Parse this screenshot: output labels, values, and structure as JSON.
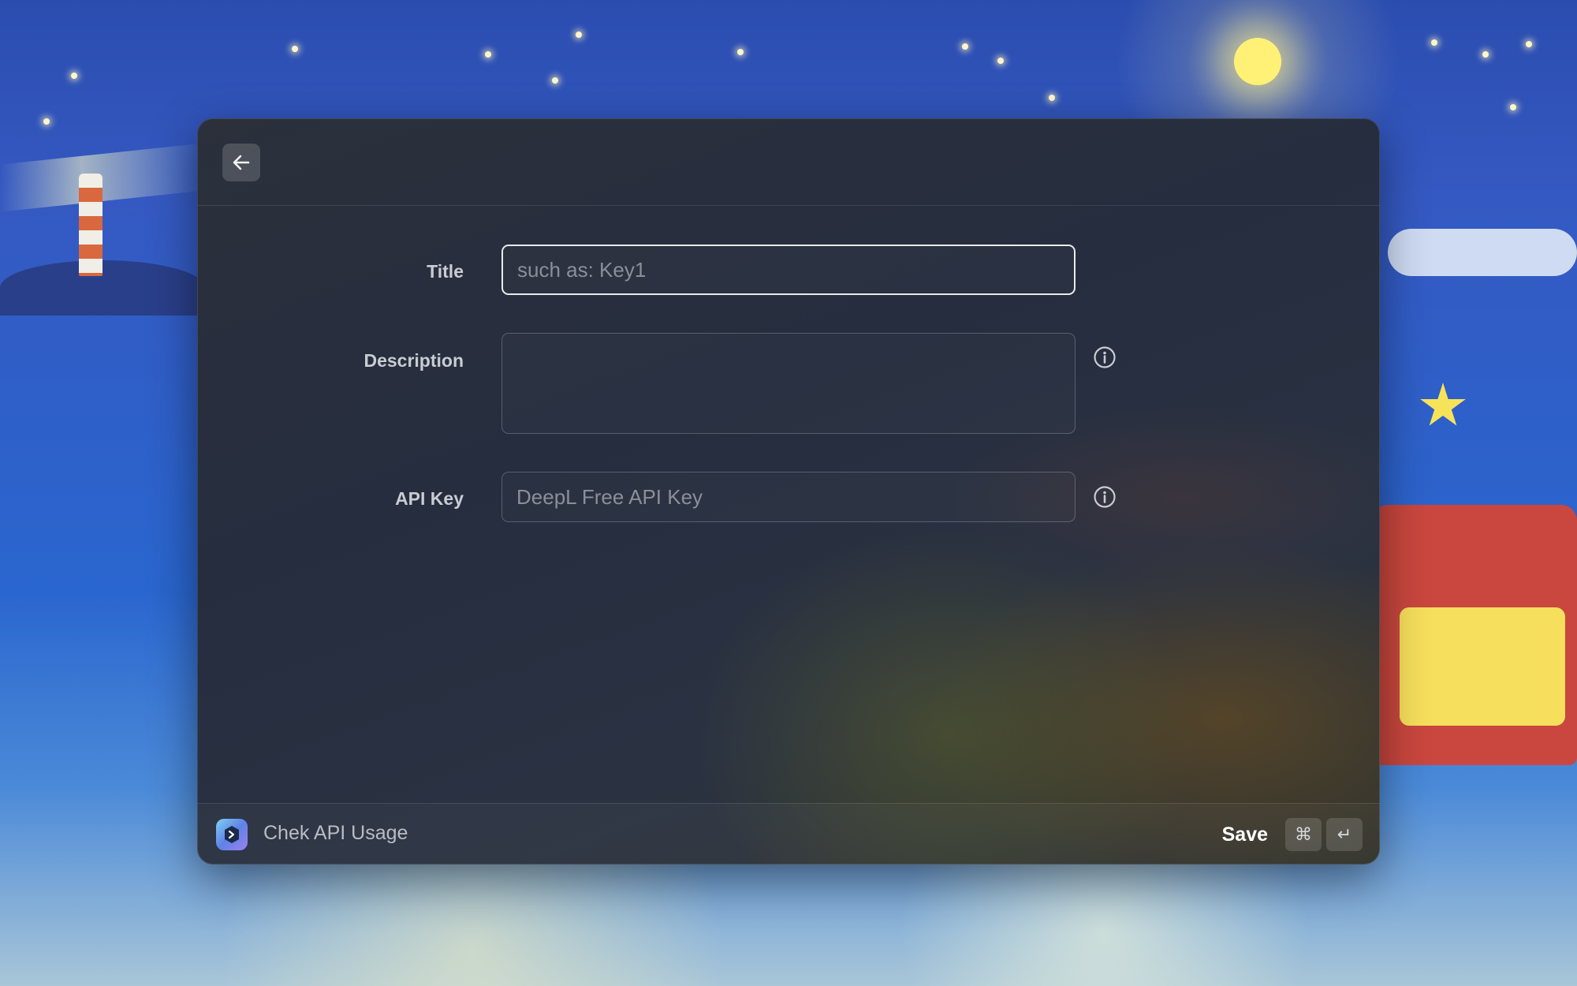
{
  "header": {
    "back_icon": "arrow-left-icon"
  },
  "form": {
    "title": {
      "label": "Title",
      "value": "",
      "placeholder": "such as: Key1"
    },
    "description": {
      "label": "Description",
      "value": "",
      "placeholder": "",
      "info_icon": "info-circle-icon"
    },
    "api_key": {
      "label": "API Key",
      "value": "",
      "placeholder": "DeepL Free API Key",
      "info_icon": "info-circle-icon"
    }
  },
  "footer": {
    "app_icon": "deepl-logo-icon",
    "app_title": "Chek API Usage",
    "save_label": "Save",
    "shortcut_keys": [
      "⌘",
      "↵"
    ]
  },
  "colors": {
    "window_bg": "#262d3f",
    "focus_border": "#e9eaec",
    "label_text": "#c9ccd2",
    "placeholder_text": "#8a8f98"
  }
}
